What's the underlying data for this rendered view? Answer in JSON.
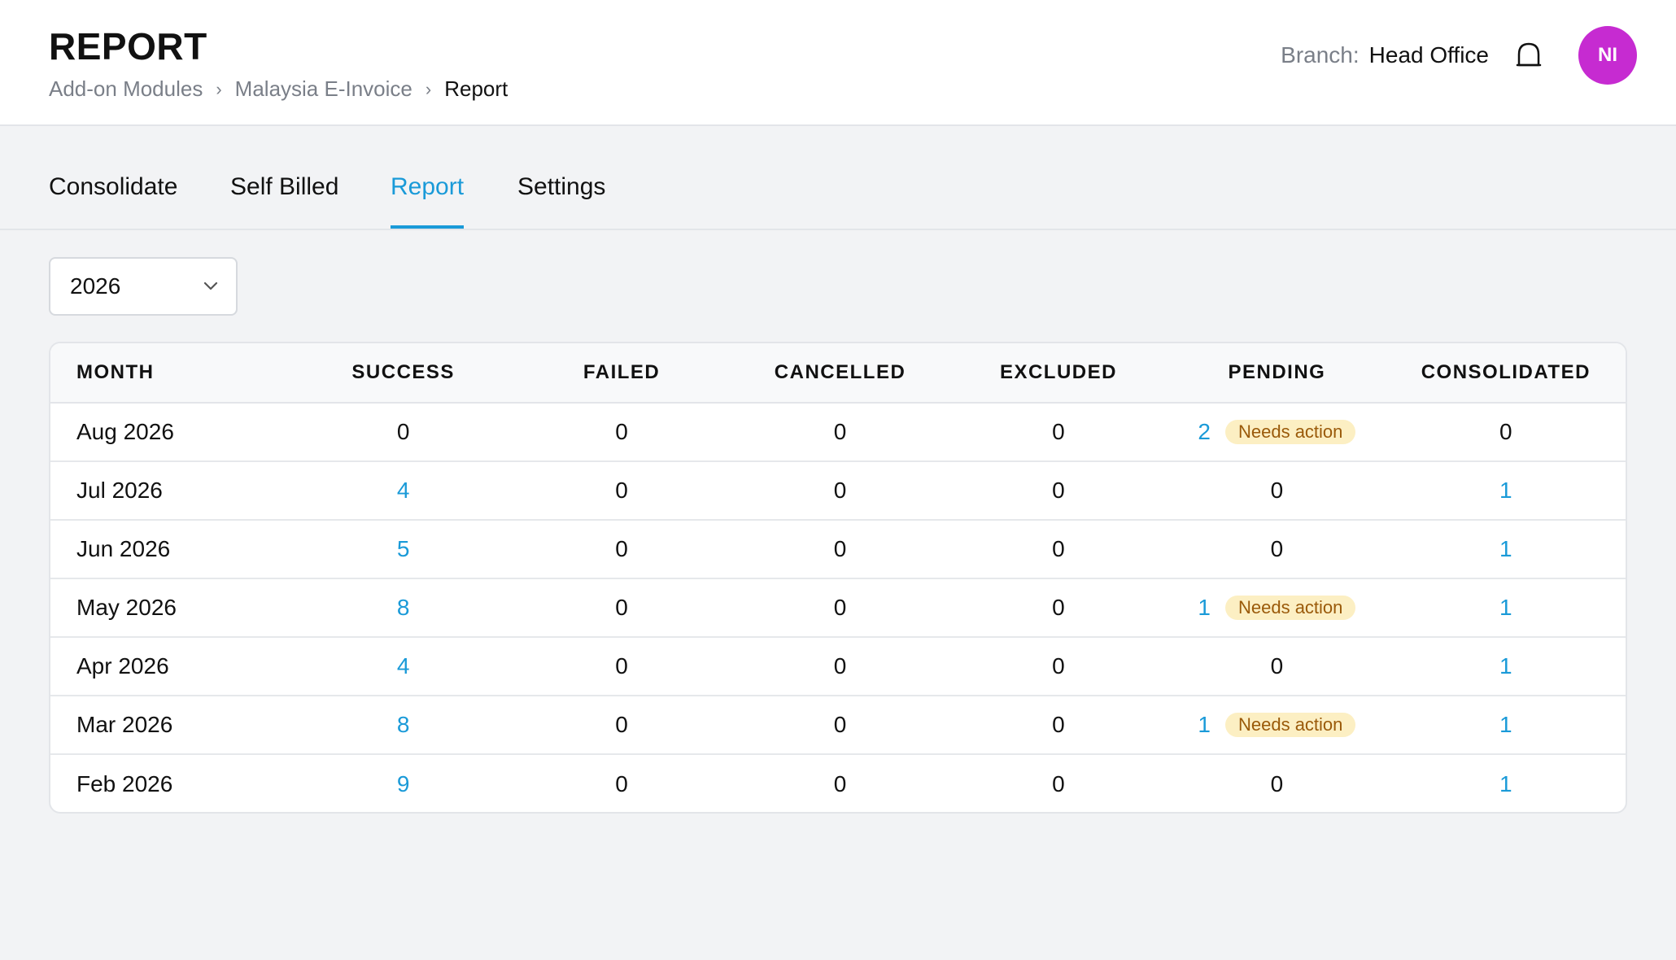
{
  "header": {
    "title": "REPORT",
    "breadcrumb": [
      "Add-on Modules",
      "Malaysia E-Invoice",
      "Report"
    ],
    "branch_label": "Branch:",
    "branch_value": "Head Office",
    "avatar_initials": "NI",
    "avatar_color": "#c62bd1"
  },
  "tabs": [
    {
      "label": "Consolidate",
      "active": false
    },
    {
      "label": "Self Billed",
      "active": false
    },
    {
      "label": "Report",
      "active": true
    },
    {
      "label": "Settings",
      "active": false
    }
  ],
  "filter": {
    "year": "2026"
  },
  "table": {
    "columns": [
      "MONTH",
      "SUCCESS",
      "FAILED",
      "CANCELLED",
      "EXCLUDED",
      "PENDING",
      "CONSOLIDATED"
    ],
    "badge_label": "Needs action",
    "rows": [
      {
        "month": "Aug 2026",
        "success": "0",
        "failed": "0",
        "cancelled": "0",
        "excluded": "0",
        "pending": "2",
        "consolidated": "0"
      },
      {
        "month": "Jul 2026",
        "success": "4",
        "failed": "0",
        "cancelled": "0",
        "excluded": "0",
        "pending": "0",
        "consolidated": "1"
      },
      {
        "month": "Jun 2026",
        "success": "5",
        "failed": "0",
        "cancelled": "0",
        "excluded": "0",
        "pending": "0",
        "consolidated": "1"
      },
      {
        "month": "May 2026",
        "success": "8",
        "failed": "0",
        "cancelled": "0",
        "excluded": "0",
        "pending": "1",
        "consolidated": "1"
      },
      {
        "month": "Apr 2026",
        "success": "4",
        "failed": "0",
        "cancelled": "0",
        "excluded": "0",
        "pending": "0",
        "consolidated": "1"
      },
      {
        "month": "Mar 2026",
        "success": "8",
        "failed": "0",
        "cancelled": "0",
        "excluded": "0",
        "pending": "1",
        "consolidated": "1"
      },
      {
        "month": "Feb 2026",
        "success": "9",
        "failed": "0",
        "cancelled": "0",
        "excluded": "0",
        "pending": "0",
        "consolidated": "1"
      }
    ]
  },
  "colors": {
    "accent": "#1a9ad8",
    "badge_bg": "#fcefc3",
    "badge_text": "#9a5a0a"
  }
}
